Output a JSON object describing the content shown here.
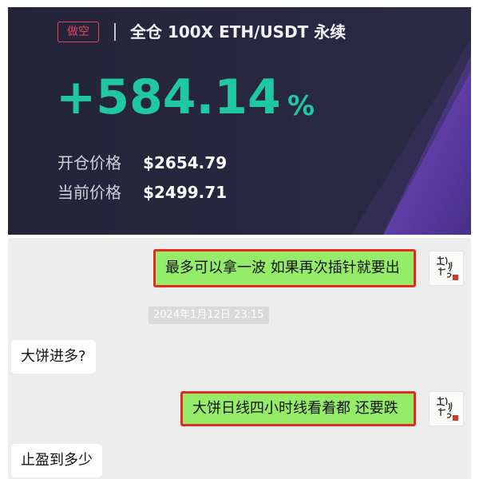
{
  "trade_card": {
    "position_side": "做空",
    "title": "全仓 100X ETH/USDT 永续",
    "pnl_value": "+584.14",
    "pnl_unit": "%",
    "open_price_label": "开仓价格",
    "open_price_value": "$2654.79",
    "current_price_label": "当前价格",
    "current_price_value": "$2499.71",
    "colors": {
      "background": "#23233a",
      "accent_purple": "#6f48c2",
      "profit_green": "#20c7a3",
      "short_red": "#e2475e"
    }
  },
  "chat": {
    "messages": [
      {
        "side": "right",
        "text": "最多可以拿一波 如果再次插针就要出",
        "highlighted": true
      },
      {
        "side": "time",
        "text": "2024年1月12日 23:15"
      },
      {
        "side": "left",
        "text": "大饼进多?"
      },
      {
        "side": "right",
        "text": "大饼日线四小时线看着都 还要跌",
        "highlighted": true
      },
      {
        "side": "left",
        "text": "止盈到多少"
      }
    ],
    "avatar_icon": "calligraphy-avatar-icon",
    "colors": {
      "background": "#ededed",
      "self_bubble": "#95ec69",
      "other_bubble": "#ffffff",
      "highlight_border": "#e02c23"
    }
  }
}
